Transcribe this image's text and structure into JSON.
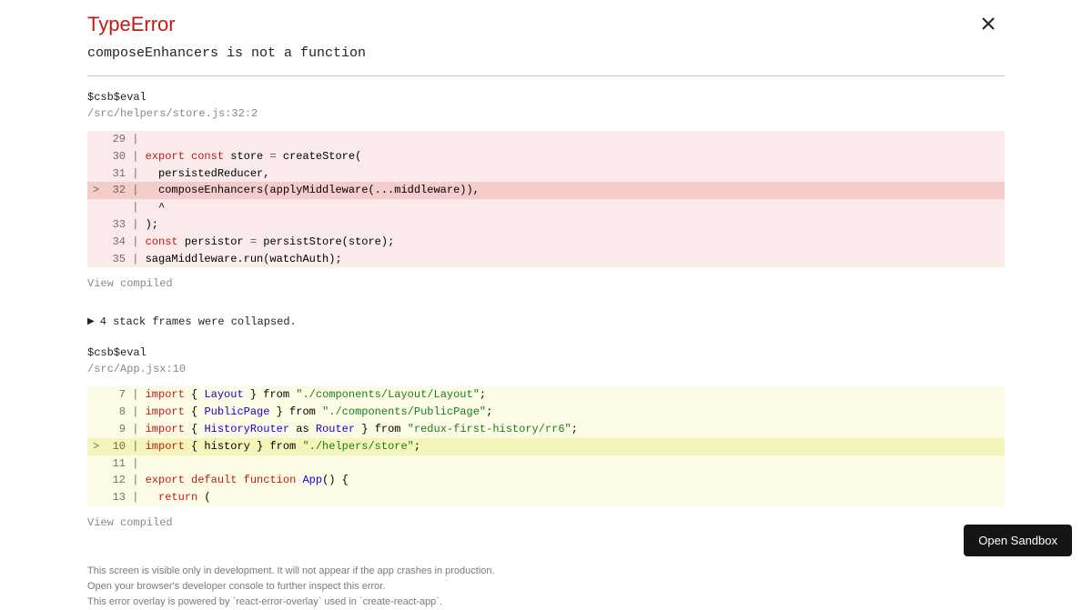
{
  "error": {
    "type": "TypeError",
    "message": "composeEnhancers is not a function"
  },
  "frames": [
    {
      "func": "$csb$eval",
      "location": "/src/helpers/store.js:32:2",
      "view_compiled": "View compiled"
    },
    {
      "func": "$csb$eval",
      "location": "/src/App.jsx:10",
      "view_compiled": "View compiled"
    }
  ],
  "collapsed": "4 stack frames were collapsed.",
  "code1": {
    "lines": [
      {
        "n": "29",
        "hl": false,
        "tokens": []
      },
      {
        "n": "30",
        "hl": false,
        "tokens": [
          [
            "key",
            "export"
          ],
          [
            "txt",
            " "
          ],
          [
            "key",
            "const"
          ],
          [
            "txt",
            " store "
          ],
          [
            "op",
            "="
          ],
          [
            "txt",
            " createStore("
          ]
        ]
      },
      {
        "n": "31",
        "hl": false,
        "tokens": [
          [
            "txt",
            "  persistedReducer,"
          ]
        ]
      },
      {
        "n": "32",
        "hl": true,
        "prefix": ">",
        "tokens": [
          [
            "txt",
            "  composeEnhancers(applyMiddleware(...middleware)),"
          ]
        ]
      },
      {
        "n": "  ",
        "hl": false,
        "tokens": [
          [
            "txt",
            "  ^"
          ]
        ]
      },
      {
        "n": "33",
        "hl": false,
        "tokens": [
          [
            "txt",
            ");"
          ]
        ]
      },
      {
        "n": "34",
        "hl": false,
        "tokens": [
          [
            "key",
            "const"
          ],
          [
            "txt",
            " persistor "
          ],
          [
            "op",
            "="
          ],
          [
            "txt",
            " persistStore(store);"
          ]
        ]
      },
      {
        "n": "35",
        "hl": false,
        "tokens": [
          [
            "txt",
            "sagaMiddleware.run(watchAuth);"
          ]
        ]
      }
    ]
  },
  "code2": {
    "lines": [
      {
        "n": " 7",
        "hl": false,
        "tokens": [
          [
            "key",
            "import"
          ],
          [
            "txt",
            " { "
          ],
          [
            "id",
            "Layout"
          ],
          [
            "txt",
            " } from "
          ],
          [
            "str",
            "\"./components/Layout/Layout\""
          ],
          [
            "txt",
            ";"
          ]
        ]
      },
      {
        "n": " 8",
        "hl": false,
        "tokens": [
          [
            "key",
            "import"
          ],
          [
            "txt",
            " { "
          ],
          [
            "id",
            "PublicPage"
          ],
          [
            "txt",
            " } from "
          ],
          [
            "str",
            "\"./components/PublicPage\""
          ],
          [
            "txt",
            ";"
          ]
        ]
      },
      {
        "n": " 9",
        "hl": false,
        "tokens": [
          [
            "key",
            "import"
          ],
          [
            "txt",
            " { "
          ],
          [
            "id",
            "HistoryRouter"
          ],
          [
            "txt",
            " as "
          ],
          [
            "id",
            "Router"
          ],
          [
            "txt",
            " } from "
          ],
          [
            "str",
            "\"redux-first-history/rr6\""
          ],
          [
            "txt",
            ";"
          ]
        ]
      },
      {
        "n": "10",
        "hl": true,
        "prefix": ">",
        "tokens": [
          [
            "key",
            "import"
          ],
          [
            "txt",
            " { history } from "
          ],
          [
            "str",
            "\"./helpers/store\""
          ],
          [
            "txt",
            ";"
          ]
        ]
      },
      {
        "n": "11",
        "hl": false,
        "tokens": []
      },
      {
        "n": "12",
        "hl": false,
        "tokens": [
          [
            "key",
            "export"
          ],
          [
            "txt",
            " "
          ],
          [
            "key",
            "default"
          ],
          [
            "txt",
            " "
          ],
          [
            "key",
            "function"
          ],
          [
            "txt",
            " "
          ],
          [
            "id",
            "App"
          ],
          [
            "txt",
            "() {"
          ]
        ]
      },
      {
        "n": "13",
        "hl": false,
        "tokens": [
          [
            "txt",
            "  "
          ],
          [
            "key",
            "return"
          ],
          [
            "txt",
            " ("
          ]
        ]
      }
    ]
  },
  "footer": {
    "l1": "This screen is visible only in development. It will not appear if the app crashes in production.",
    "l2": "Open your browser's developer console to further inspect this error.",
    "l3": "This error overlay is powered by `react-error-overlay` used in `create-react-app`."
  },
  "button": "Open Sandbox"
}
